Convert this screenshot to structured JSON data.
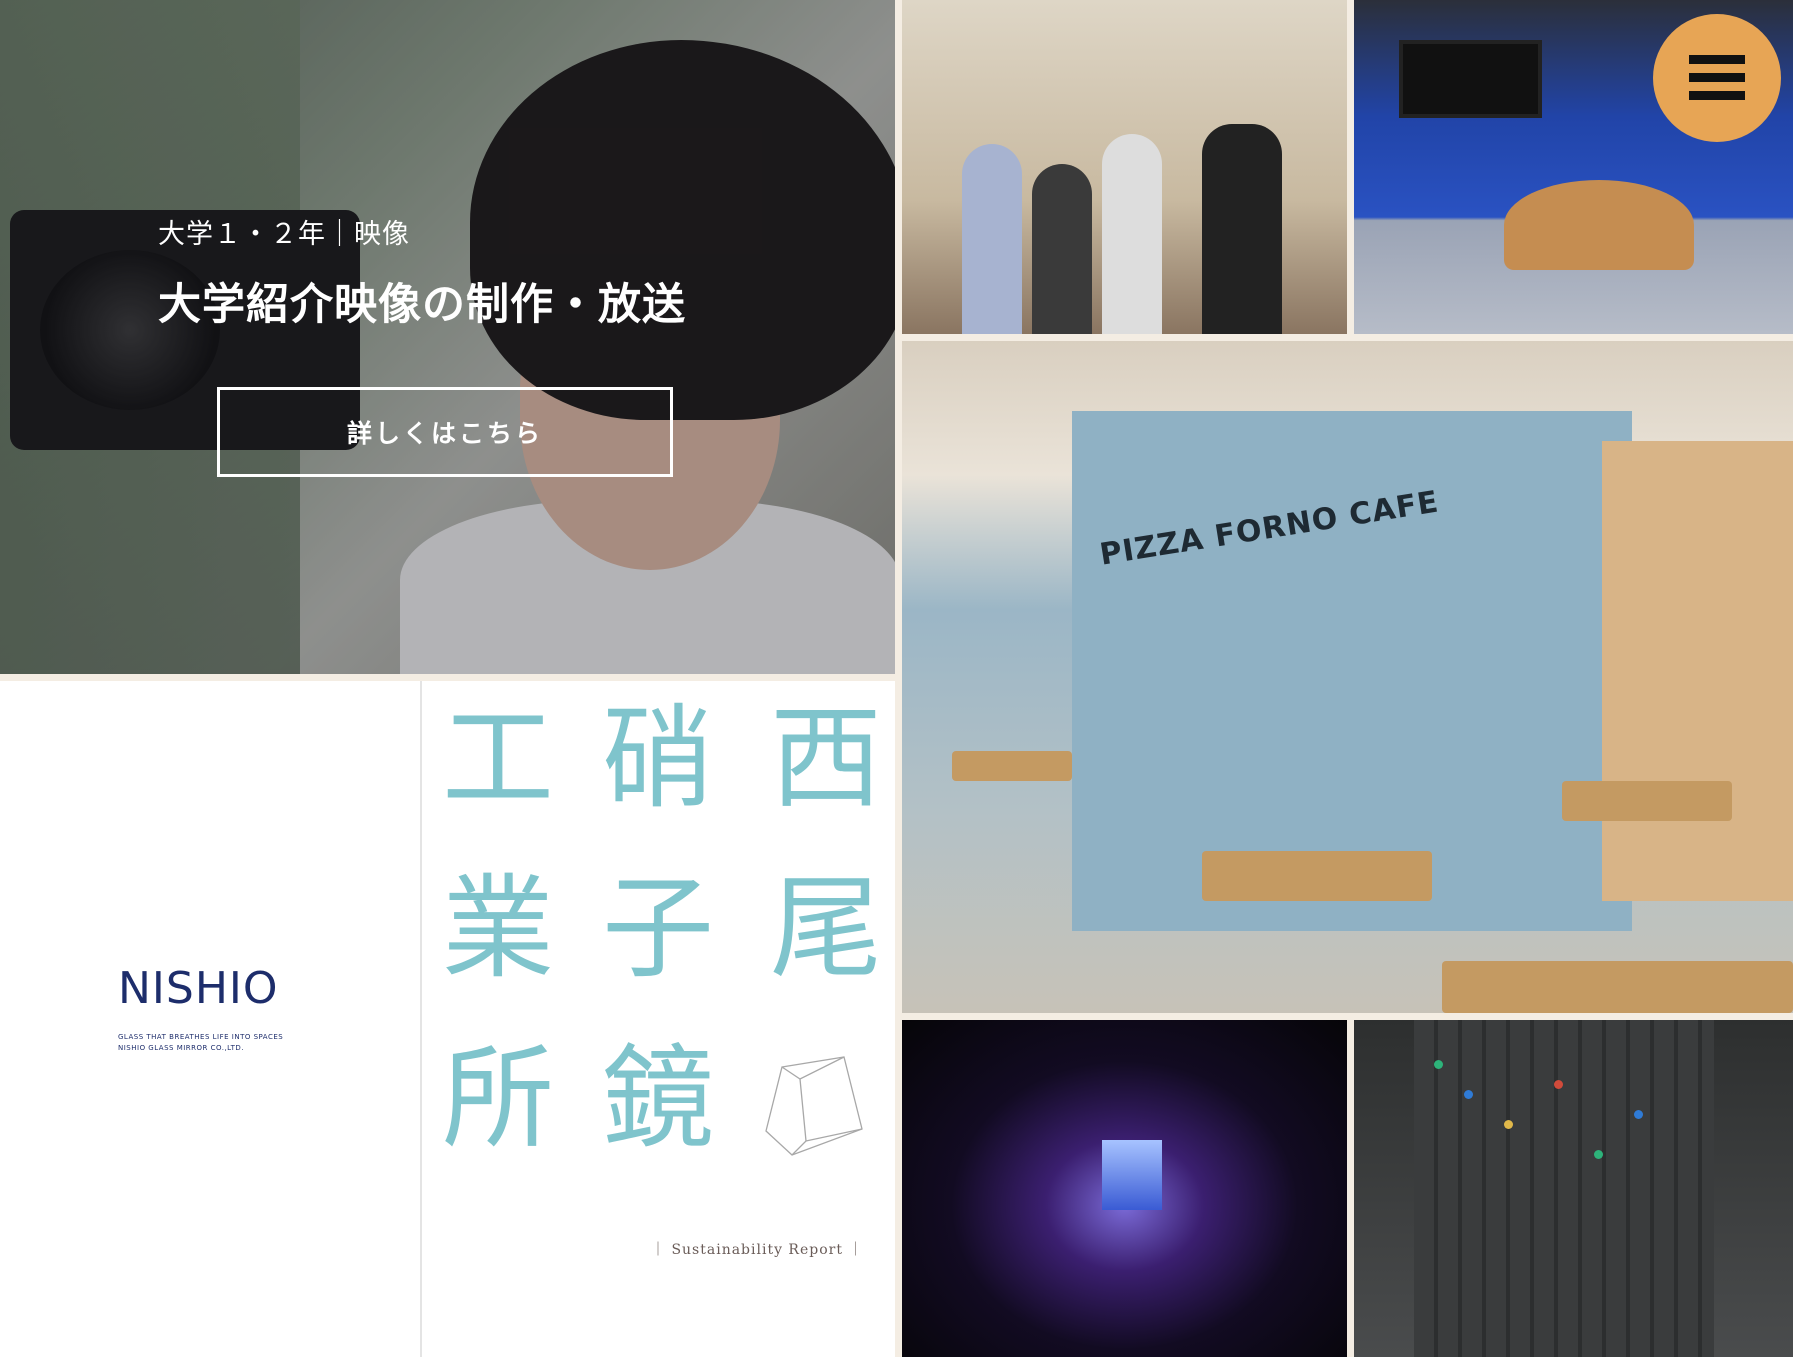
{
  "hero": {
    "eyebrow": "大学１・２年｜映像",
    "headline": "大学紹介映像の制作・放送",
    "cta_label": "詳しくはこちら"
  },
  "report": {
    "logo_text": "NISHIO",
    "logo_tagline_1": "GLASS THAT BREATHES LIFE INTO SPACES",
    "logo_tagline_2": "NISHIO GLASS MIRROR CO.,LTD.",
    "title_columns": [
      [
        "西",
        "尾"
      ],
      [
        "硝",
        "子",
        "鏡"
      ],
      [
        "工",
        "業",
        "所"
      ]
    ],
    "caption": "｜ Sustainability Report ｜"
  },
  "photos": {
    "cafe_sign": "PIZZA FORNO CAFE"
  },
  "menu": {
    "icon": "hamburger-menu-icon",
    "color": "#e7a555"
  },
  "colors": {
    "background": "#f4ede3",
    "kanji": "#7fc4cc",
    "logo": "#1d2d6b"
  }
}
